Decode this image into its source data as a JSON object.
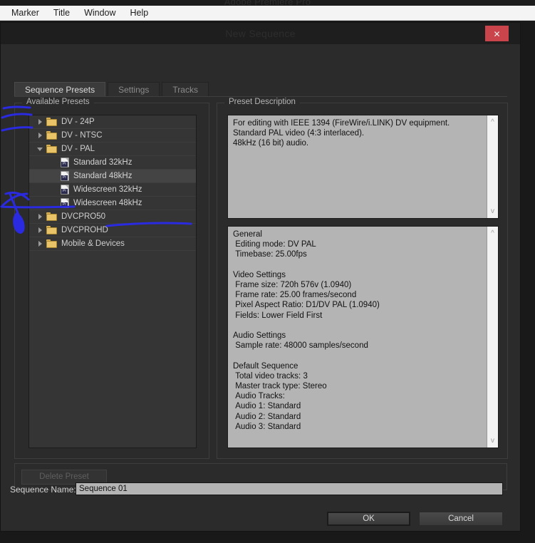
{
  "app": {
    "title": "Adobe Premiere Pro",
    "menubar": [
      "Marker",
      "Title",
      "Window",
      "Help"
    ]
  },
  "dialog": {
    "title": "New Sequence",
    "close_icon": "close-x-icon"
  },
  "tabs": [
    {
      "label": "Sequence Presets",
      "active": true
    },
    {
      "label": "Settings",
      "active": false
    },
    {
      "label": "Tracks",
      "active": false
    }
  ],
  "presets": {
    "group_label": "Available Presets",
    "tree": [
      {
        "label": "DV - 24P",
        "type": "folder",
        "level": 0,
        "expanded": false,
        "selected": false
      },
      {
        "label": "DV - NTSC",
        "type": "folder",
        "level": 0,
        "expanded": false,
        "selected": false
      },
      {
        "label": "DV - PAL",
        "type": "folder",
        "level": 0,
        "expanded": true,
        "selected": false
      },
      {
        "label": "Standard 32kHz",
        "type": "preset",
        "level": 1,
        "expanded": null,
        "selected": false
      },
      {
        "label": "Standard 48kHz",
        "type": "preset",
        "level": 1,
        "expanded": null,
        "selected": true
      },
      {
        "label": "Widescreen 32kHz",
        "type": "preset",
        "level": 1,
        "expanded": null,
        "selected": false
      },
      {
        "label": "Widescreen 48kHz",
        "type": "preset",
        "level": 1,
        "expanded": null,
        "selected": false
      },
      {
        "label": "DVCPRO50",
        "type": "folder",
        "level": 0,
        "expanded": false,
        "selected": false
      },
      {
        "label": "DVCPROHD",
        "type": "folder",
        "level": 0,
        "expanded": false,
        "selected": false
      },
      {
        "label": "Mobile & Devices",
        "type": "folder",
        "level": 0,
        "expanded": false,
        "selected": false
      }
    ]
  },
  "description": {
    "group_label": "Preset Description",
    "summary": "For editing with IEEE 1394 (FireWire/i.LINK) DV equipment.\nStandard PAL video (4:3 interlaced).\n48kHz (16 bit) audio.",
    "details": "General\n Editing mode: DV PAL\n Timebase: 25.00fps\n\nVideo Settings\n Frame size: 720h 576v (1.0940)\n Frame rate: 25.00 frames/second\n Pixel Aspect Ratio: D1/DV PAL (1.0940)\n Fields: Lower Field First\n\nAudio Settings\n Sample rate: 48000 samples/second\n\nDefault Sequence\n Total video tracks: 3\n Master track type: Stereo\n Audio Tracks:\n Audio 1: Standard\n Audio 2: Standard\n Audio 3: Standard",
    "scroll_up_icon": "chevron-up-icon",
    "scroll_down_icon": "chevron-down-icon"
  },
  "actions": {
    "delete_preset": "Delete Preset",
    "ok": "OK",
    "cancel": "Cancel"
  },
  "sequence_name": {
    "label": "Sequence Name:",
    "value": "Sequence 01"
  },
  "colors": {
    "accent_close": "#c9444b",
    "dialog_bg": "#2b2b2b",
    "panel_bg": "#b4b4b4",
    "annotation_blue": "#2a2ae0",
    "folder_yellow": "#e8c368"
  }
}
